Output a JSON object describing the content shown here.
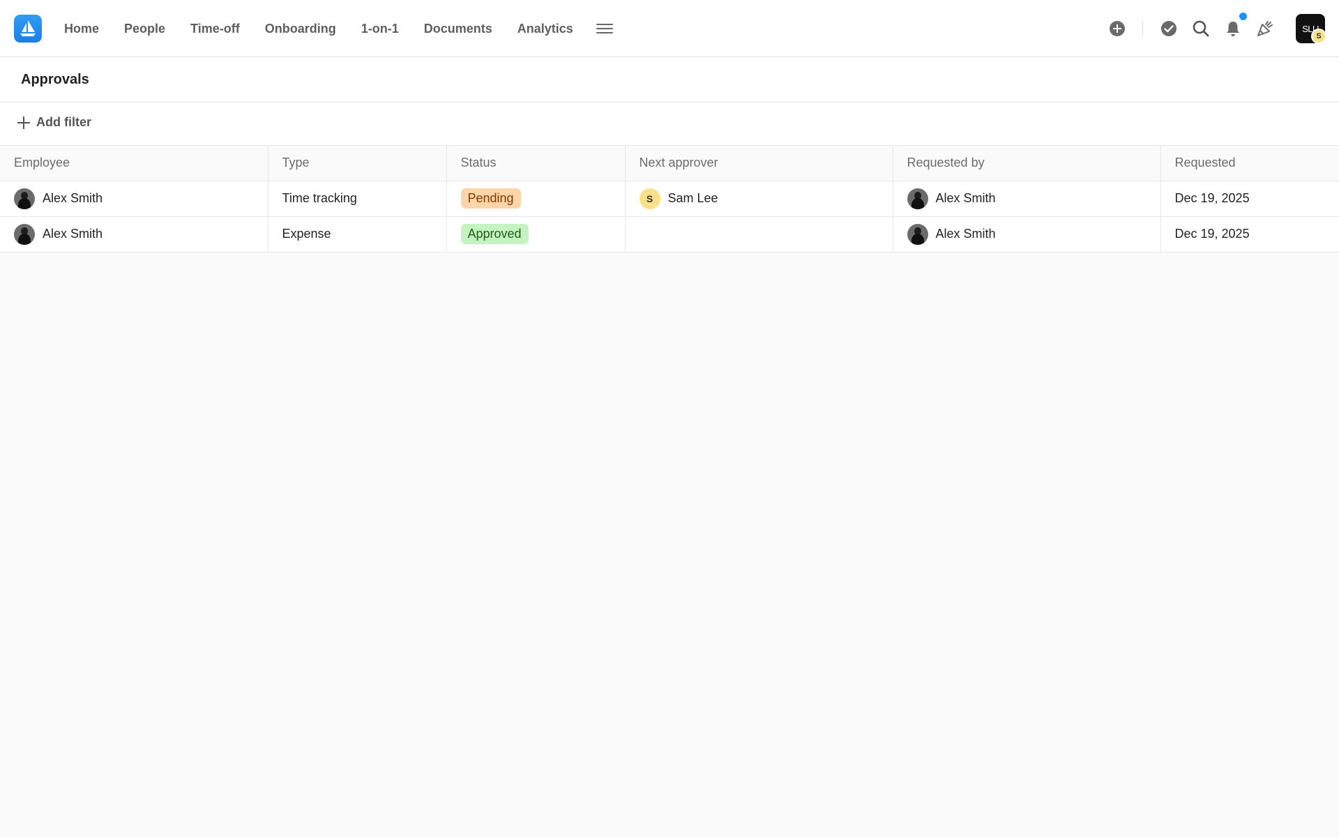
{
  "nav": {
    "items": [
      "Home",
      "People",
      "Time-off",
      "Onboarding",
      "1-on-1",
      "Documents",
      "Analytics"
    ]
  },
  "header": {
    "account_label": "SLU",
    "account_badge": "S"
  },
  "page": {
    "title": "Approvals",
    "add_filter": "Add filter"
  },
  "table": {
    "columns": [
      "Employee",
      "Type",
      "Status",
      "Next approver",
      "Requested by",
      "Requested"
    ],
    "rows": [
      {
        "employee": "Alex Smith",
        "type": "Time tracking",
        "status": "Pending",
        "next_approver": "Sam Lee",
        "next_approver_initial": "S",
        "requested_by": "Alex Smith",
        "requested": "Dec 19, 2025"
      },
      {
        "employee": "Alex Smith",
        "type": "Expense",
        "status": "Approved",
        "next_approver": "",
        "next_approver_initial": "",
        "requested_by": "Alex Smith",
        "requested": "Dec 19, 2025"
      }
    ]
  },
  "colors": {
    "accent": "#1e90ff",
    "pending_bg": "#fdd5a8",
    "approved_bg": "#c4f2c0"
  }
}
